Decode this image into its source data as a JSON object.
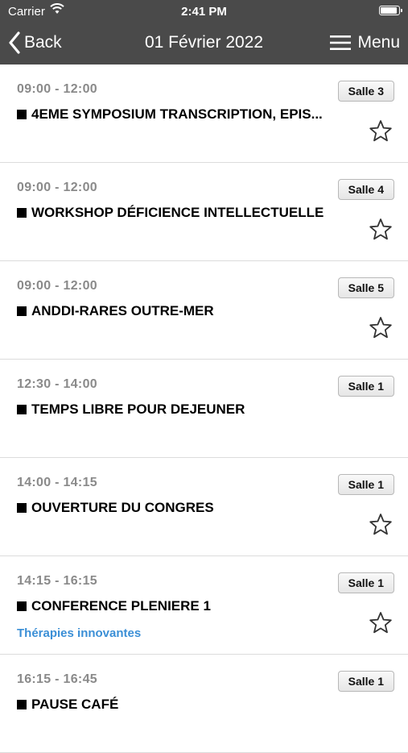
{
  "status_bar": {
    "carrier": "Carrier",
    "time": "2:41 PM",
    "battery_level": 0.9
  },
  "nav": {
    "back_label": "Back",
    "title": "01 Février 2022",
    "menu_label": "Menu"
  },
  "colors": {
    "header_bg": "#4a4a4a",
    "subtitle": "#3b8fd6",
    "time_text": "#8a8a8a"
  },
  "sessions": [
    {
      "time": "09:00 - 12:00",
      "room": "Salle 3",
      "title": "4EME SYMPOSIUM TRANSCRIPTION, EPIS...",
      "subtitle": "",
      "favorite": true
    },
    {
      "time": "09:00 - 12:00",
      "room": "Salle 4",
      "title": "WORKSHOP DÉFICIENCE INTELLECTUELLE",
      "subtitle": "",
      "favorite": true
    },
    {
      "time": "09:00 - 12:00",
      "room": "Salle 5",
      "title": "ANDDI-RARES OUTRE-MER",
      "subtitle": "",
      "favorite": true
    },
    {
      "time": "12:30 - 14:00",
      "room": "Salle 1",
      "title": "TEMPS LIBRE POUR DEJEUNER",
      "subtitle": "",
      "favorite": false
    },
    {
      "time": "14:00 - 14:15",
      "room": "Salle 1",
      "title": "OUVERTURE DU CONGRES",
      "subtitle": "",
      "favorite": true
    },
    {
      "time": "14:15 - 16:15",
      "room": "Salle 1",
      "title": "CONFERENCE PLENIERE 1",
      "subtitle": "Thérapies innovantes",
      "favorite": true
    },
    {
      "time": "16:15 - 16:45",
      "room": "Salle 1",
      "title": "PAUSE CAFÉ",
      "subtitle": "",
      "favorite": false
    }
  ]
}
